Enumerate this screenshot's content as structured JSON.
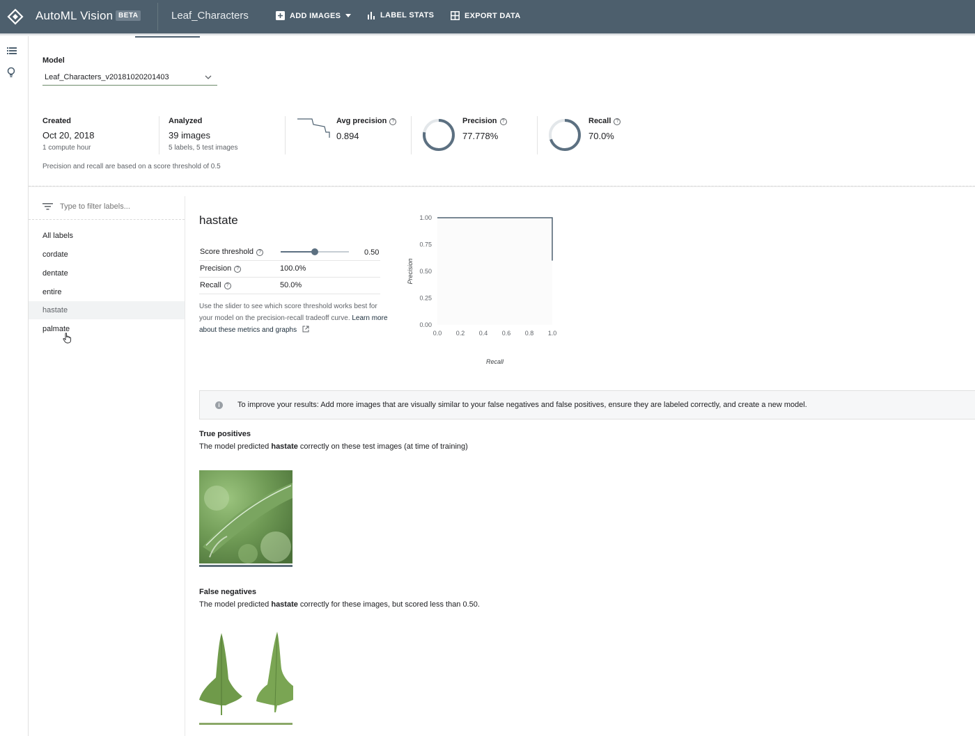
{
  "topbar": {
    "app_title": "AutoML Vision",
    "beta": "BETA",
    "dataset": "Leaf_Characters",
    "add_images": "ADD IMAGES",
    "label_stats": "LABEL STATS",
    "export_data": "EXPORT DATA"
  },
  "rail": {
    "icons": [
      "list-icon",
      "lightbulb-icon"
    ]
  },
  "model": {
    "label": "Model",
    "selected": "Leaf_Characters_v20181020201403"
  },
  "stats": {
    "created_label": "Created",
    "created_value": "Oct 20, 2018",
    "created_sub": "1 compute hour",
    "analyzed_label": "Analyzed",
    "analyzed_value": "39 images",
    "analyzed_sub": "5 labels, 5 test images",
    "avg_precision_label": "Avg precision",
    "avg_precision_value": "0.894",
    "precision_label": "Precision",
    "precision_value": "77.778%",
    "precision_fraction": 0.778,
    "recall_label": "Recall",
    "recall_value": "70.0%",
    "recall_fraction": 0.7,
    "note": "Precision and recall are based on a score threshold of 0.5"
  },
  "filter": {
    "placeholder": "Type to filter labels..."
  },
  "labels": [
    "All labels",
    "cordate",
    "dentate",
    "entire",
    "hastate",
    "palmate"
  ],
  "active_label": "hastate",
  "detail": {
    "title": "hastate",
    "threshold_label": "Score threshold",
    "threshold_value": "0.50",
    "threshold_fraction": 0.5,
    "precision_label": "Precision",
    "precision_value": "100.0%",
    "recall_label": "Recall",
    "recall_value": "50.0%",
    "help_text": "Use the slider to see which score threshold works best for your model on the precision-recall tradeoff curve.",
    "learn_link": "Learn more about these metrics and graphs"
  },
  "chart_data": {
    "type": "line",
    "title": "",
    "xlabel": "Recall",
    "ylabel": "Precision",
    "xlim": [
      0.0,
      1.0
    ],
    "ylim": [
      0.0,
      1.0
    ],
    "x_ticks": [
      "0.0",
      "0.2",
      "0.4",
      "0.6",
      "0.8",
      "1.0"
    ],
    "y_ticks": [
      "1.00",
      "0.75",
      "0.50",
      "0.25",
      "0.00"
    ],
    "series": [
      {
        "x": [
          0.0,
          1.0,
          1.0
        ],
        "y": [
          1.0,
          1.0,
          0.6
        ]
      }
    ],
    "grid": false,
    "line_color": "#4d6070"
  },
  "banner": {
    "text": "To improve your results: Add more images that are visually similar to your false negatives and false positives, ensure they are labeled correctly, and create a new model."
  },
  "true_positives": {
    "title": "True positives",
    "desc_pre": "The model predicted ",
    "desc_label": "hastate",
    "desc_post": " correctly on these test images (at time of training)"
  },
  "false_negatives": {
    "title": "False negatives",
    "desc_pre": "The model predicted ",
    "desc_label": "hastate",
    "desc_post": " correctly for these images, but scored less than 0.50."
  },
  "colors": {
    "topbar": "#4d5f6d",
    "accent": "#5c7081",
    "tp_bar": "#5c6e79",
    "fn_bar": "#8aa868"
  }
}
